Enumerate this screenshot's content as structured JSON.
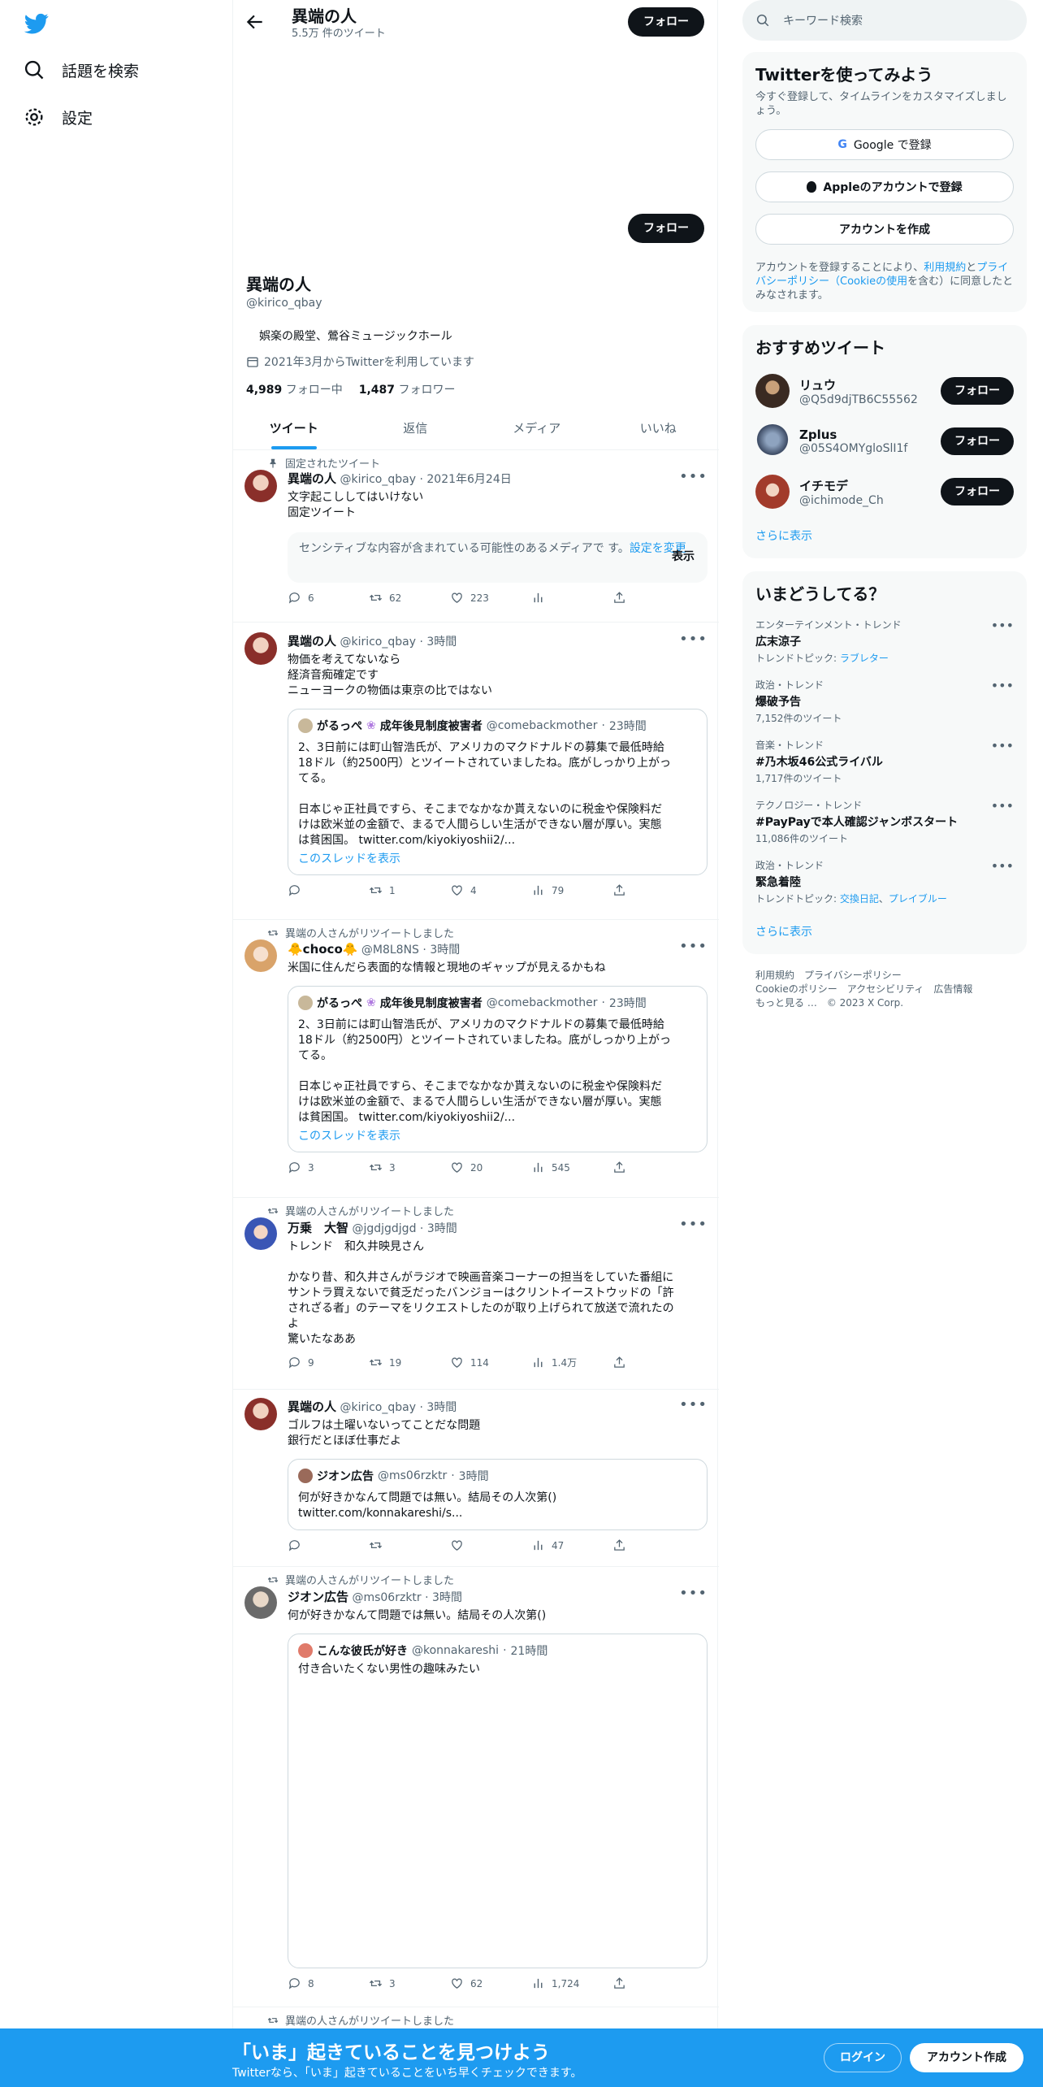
{
  "nav": {
    "explore": "話題を検索",
    "settings": "設定"
  },
  "header": {
    "name": "異端の人",
    "tweet_count": "5.5万 件のツイート",
    "follow": "フォロー"
  },
  "profile": {
    "name": "異端の人",
    "handle": "@kirico_qbay",
    "bio": "娯楽の殿堂、鶯谷ミュージックホール",
    "joined": "2021年3月からTwitterを利用しています",
    "following_num": "4,989",
    "following_label": "フォロー中",
    "followers_num": "1,487",
    "followers_label": "フォロワー",
    "follow": "フォロー"
  },
  "tabs": [
    "ツイート",
    "返信",
    "メディア",
    "いいね"
  ],
  "tweets": [
    {
      "context": "固定されたツイート",
      "name": "異端の人",
      "handle": "@kirico_qbay",
      "time": "2021年6月24日",
      "text": "文字起こししてはいけない\n固定ツイート",
      "sensitive": "センシティブな内容が含まれている可能性のあるメディアで\nす。",
      "sensitive_link": "設定を変更",
      "show": "表示",
      "replies": "6",
      "retweets": "62",
      "likes": "223",
      "views": ""
    },
    {
      "name": "異端の人",
      "handle": "@kirico_qbay",
      "time": "3時間",
      "text": "物価を考えてないなら\n経済音痴確定です\nニューヨークの物価は東京の比ではない",
      "quote": {
        "name": "がるっぺ",
        "name2": "成年後見制度被害者",
        "handle": "@comebackmother",
        "time": "23時間",
        "text": "2、3日前には町山智浩氏が、アメリカのマクドナルドの募集で最低時給\n18ドル（約2500円）とツイートされていましたね。底がしっかり上がっ\nてる。\n\n日本じゃ正社員ですら、そこまでなかなか貰えないのに税金や保険料だ\nけは欧米並の金額で、まるで人間らしい生活ができない層が厚い。実態\nは貧困国。 twitter.com/kiyokiyoshii2/...",
        "link": "このスレッドを表示"
      },
      "replies": "",
      "retweets": "1",
      "likes": "4",
      "views": "79"
    },
    {
      "context": "異端の人さんがリツイートしました",
      "name": "🐥choco🐥",
      "handle": "@M8L8NS",
      "time": "3時間",
      "text": "米国に住んだら表面的な情報と現地のギャップが見えるかもね",
      "quote": {
        "name": "がるっぺ",
        "name2": "成年後見制度被害者",
        "handle": "@comebackmother",
        "time": "23時間",
        "text": "2、3日前には町山智浩氏が、アメリカのマクドナルドの募集で最低時給\n18ドル（約2500円）とツイートされていましたね。底がしっかり上がっ\nてる。\n\n日本じゃ正社員ですら、そこまでなかなか貰えないのに税金や保険料だ\nけは欧米並の金額で、まるで人間らしい生活ができない層が厚い。実態\nは貧困国。 twitter.com/kiyokiyoshii2/...",
        "link": "このスレッドを表示"
      },
      "replies": "3",
      "retweets": "3",
      "likes": "20",
      "views": "545"
    },
    {
      "context": "異端の人さんがリツイートしました",
      "name": "万乗　大智",
      "handle": "@jgdjgdjgd",
      "time": "3時間",
      "text": "トレンド　和久井映見さん\n\nかなり昔、和久井さんがラジオで映画音楽コーナーの担当をしていた番組に\nサントラ買えないで貧乏だったバンジョーはクリントイーストウッドの「許\nされざる者」のテーマをリクエストしたのが取り上げられて放送で流れたの\nよ\n驚いたなああ",
      "replies": "9",
      "retweets": "19",
      "likes": "114",
      "views": "1.4万"
    },
    {
      "name": "異端の人",
      "handle": "@kirico_qbay",
      "time": "3時間",
      "text": "ゴルフは土曜いないってことだな問題\n銀行だとほぼ仕事だよ",
      "quote": {
        "name": "ジオン広告",
        "handle": "@ms06rzktr",
        "time": "3時間",
        "text": "何が好きかなんて問題では無い。結局その人次第()\ntwitter.com/konnakareshi/s..."
      },
      "replies": "",
      "retweets": "",
      "likes": "",
      "views": "47"
    },
    {
      "context": "異端の人さんがリツイートしました",
      "name": "ジオン広告",
      "handle": "@ms06rzktr",
      "time": "3時間",
      "text": "何が好きかなんて問題では無い。結局その人次第()",
      "quote": {
        "name": "こんな彼氏が好き",
        "handle": "@konnakareshi",
        "time": "21時間",
        "text": "付き合いたくない男性の趣味みたい"
      },
      "replies": "8",
      "retweets": "3",
      "likes": "62",
      "views": "1,724"
    },
    {
      "context": "異端の人さんがリツイートしました"
    }
  ],
  "search": {
    "placeholder": "キーワード検索"
  },
  "signup": {
    "title": "Twitterを使ってみよう",
    "desc": "今すぐ登録して、タイムラインをカスタマイズしましょう。",
    "google": "Google で登録",
    "apple": "Appleのアカウントで登録",
    "create": "アカウントを作成",
    "legal_pre": "アカウントを登録することにより、",
    "terms": "利用規約",
    "and": "と",
    "privacy": "プライバシーポリシー",
    "cookie": "（Cookieの使用",
    "legal_post": "を含む）に同意したとみなされます。"
  },
  "recommend": {
    "title": "おすすめツイート",
    "users": [
      {
        "name": "リュウ",
        "handle": "@Q5d9djTB6C55562"
      },
      {
        "name": "Zplus",
        "handle": "@05S4OMYgloSlI1f"
      },
      {
        "name": "イチモデ",
        "handle": "@ichimode_Ch"
      }
    ],
    "follow": "フォロー",
    "more": "さらに表示"
  },
  "trends": {
    "title": "いまどうしてる？",
    "items": [
      {
        "cat": "エンターテインメント・トレンド",
        "name": "広末涼子",
        "sub_pre": "トレンドトピック: ",
        "sub_links": [
          "ラブレター"
        ]
      },
      {
        "cat": "政治・トレンド",
        "name": "爆破予告",
        "sub_pre": "7,152件のツイート",
        "sub_links": []
      },
      {
        "cat": "音楽・トレンド",
        "name": "#乃木坂46公式ライバル",
        "sub_pre": "1,717件のツイート",
        "sub_links": []
      },
      {
        "cat": "テクノロジー・トレンド",
        "name": "#PayPayで本人確認ジャンボスタート",
        "sub_pre": "11,086件のツイート",
        "sub_links": []
      },
      {
        "cat": "政治・トレンド",
        "name": "緊急着陸",
        "sub_pre": "トレンドトピック: ",
        "sub_links": [
          "交換日記",
          "プレイブルー"
        ]
      }
    ],
    "more": "さらに表示"
  },
  "footer": {
    "line1": "利用規約　プライバシーポリシー",
    "line2": "Cookieのポリシー　アクセシビリティ　広告情報",
    "line3": "もっと見る …　© 2023 X Corp."
  },
  "bottom": {
    "title": "「いま」起きていることを見つけよう",
    "sub": "Twitterなら、「いま」起きていることをいち早くチェックできます。",
    "login": "ログイン",
    "signup": "アカウント作成"
  },
  "colors": {
    "accent": "#1d9bf0",
    "text": "#0f1419",
    "muted": "#536471"
  }
}
